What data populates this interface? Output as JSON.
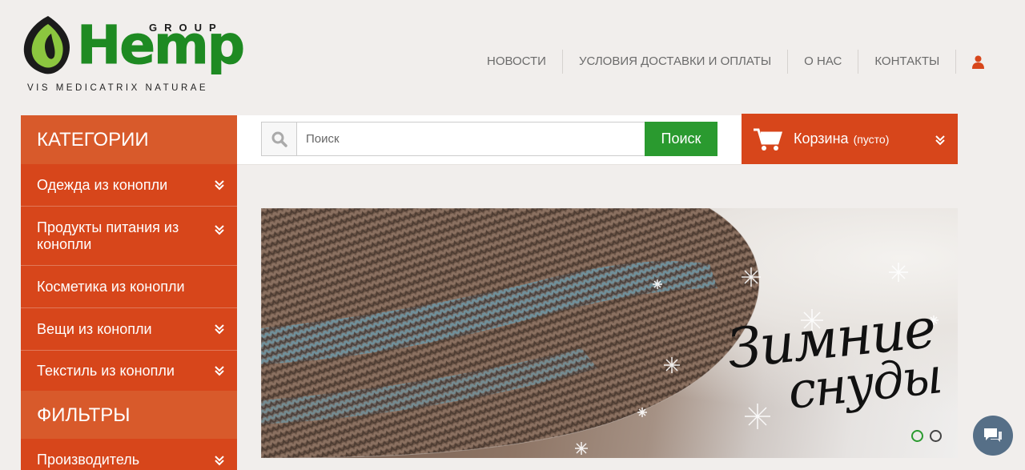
{
  "logo": {
    "group_text": "GROUP",
    "brand_text": "Hemp",
    "tagline": "VIS MEDICATRIX NATURAE",
    "brand_color": "#1e8a22"
  },
  "topnav": {
    "items": [
      {
        "label": "НОВОСТИ"
      },
      {
        "label": "УСЛОВИЯ ДОСТАВКИ И ОПЛАТЫ"
      },
      {
        "label": "О НАС"
      },
      {
        "label": "КОНТАКТЫ"
      }
    ],
    "user_icon": "user-icon"
  },
  "sidebar": {
    "categories_title": "КАТЕГОРИИ",
    "items": [
      {
        "label": "Одежда из конопли",
        "has_submenu": true
      },
      {
        "label": "Продукты питания из конопли",
        "has_submenu": true
      },
      {
        "label": "Косметика из конопли",
        "has_submenu": false
      },
      {
        "label": "Вещи из конопли",
        "has_submenu": true
      },
      {
        "label": "Текстиль из конопли",
        "has_submenu": true
      }
    ],
    "filters_title": "ФИЛЬТРЫ",
    "filters": [
      {
        "label": "Производитель",
        "has_submenu": true
      }
    ],
    "accent_color": "#d7461b"
  },
  "search": {
    "placeholder": "Поиск",
    "value": "",
    "button_label": "Поиск",
    "button_color": "#2a9a2f"
  },
  "cart": {
    "label": "Корзина",
    "status": "(пусто)"
  },
  "banner": {
    "line1": "Зимние",
    "line2": "снуды",
    "slides_total": 2,
    "active_slide": 1
  },
  "chat": {
    "icon": "chat-icon",
    "color": "#566f87"
  }
}
